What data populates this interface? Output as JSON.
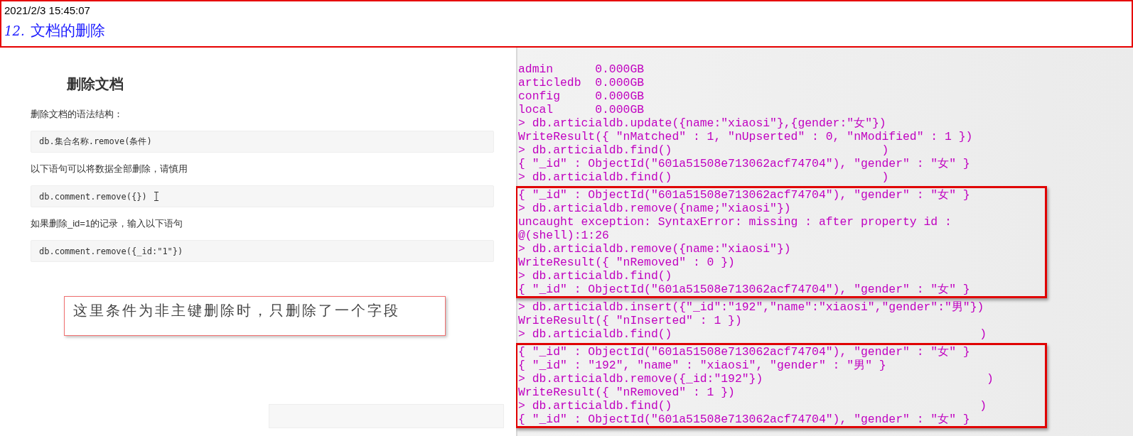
{
  "note": {
    "timestamp": "2021/2/3 15:45:07",
    "number": "12.",
    "title": "文档的删除"
  },
  "article": {
    "heading": "删除文档",
    "items": [
      {
        "kind": "text",
        "text": "删除文档的语法结构："
      },
      {
        "kind": "code",
        "text": "db.集合名称.remove(条件)",
        "cursor": false
      },
      {
        "kind": "text",
        "text": "以下语句可以将数据全部删除，请慎用"
      },
      {
        "kind": "code",
        "text": "db.comment.remove({})",
        "cursor": true
      },
      {
        "kind": "text",
        "text": "如果删除_id=1的记录，输入以下语句"
      },
      {
        "kind": "code",
        "text": "db.comment.remove({_id:\"1\"})",
        "cursor": false
      }
    ],
    "callout": "这里条件为非主键删除时，只删除了一个字段"
  },
  "terminal": {
    "blocks": [
      {
        "kind": "plain",
        "lines": [
          "admin      0.000GB",
          "articledb  0.000GB",
          "config     0.000GB",
          "local      0.000GB",
          "> db.articialdb.update({name:\"xiaosi\"},{gender:\"女\"})",
          "WriteResult({ \"nMatched\" : 1, \"nUpserted\" : 0, \"nModified\" : 1 })",
          "> db.articialdb.find()                              )",
          "{ \"_id\" : ObjectId(\"601a51508e713062acf74704\"), \"gender\" : \"女\" }",
          "> db.articialdb.find()                              )"
        ]
      },
      {
        "kind": "highlighted",
        "lines": [
          "{ \"_id\" : ObjectId(\"601a51508e713062acf74704\"), \"gender\" : \"女\" }",
          "> db.articialdb.remove({name;\"xiaosi\"})",
          "uncaught exception: SyntaxError: missing : after property id :",
          "@(shell):1:26",
          "> db.articialdb.remove({name:\"xiaosi\"})",
          "WriteResult({ \"nRemoved\" : 0 })",
          "> db.articialdb.find()",
          "{ \"_id\" : ObjectId(\"601a51508e713062acf74704\"), \"gender\" : \"女\" }"
        ]
      },
      {
        "kind": "plain",
        "lines": [
          "> db.articialdb.insert({\"_id\":\"192\",\"name\":\"xiaosi\",\"gender\":\"男\"})",
          "WriteResult({ \"nInserted\" : 1 })",
          "> db.articialdb.find()                                            )"
        ]
      },
      {
        "kind": "highlighted",
        "lines": [
          "{ \"_id\" : ObjectId(\"601a51508e713062acf74704\"), \"gender\" : \"女\" }",
          "{ \"_id\" : \"192\", \"name\" : \"xiaosi\", \"gender\" : \"男\" }",
          "> db.articialdb.remove({_id:\"192\"})                                )",
          "WriteResult({ \"nRemoved\" : 1 })",
          "> db.articialdb.find()                                            )",
          "{ \"_id\" : ObjectId(\"601a51508e713062acf74704\"), \"gender\" : \"女\" }"
        ]
      }
    ]
  }
}
